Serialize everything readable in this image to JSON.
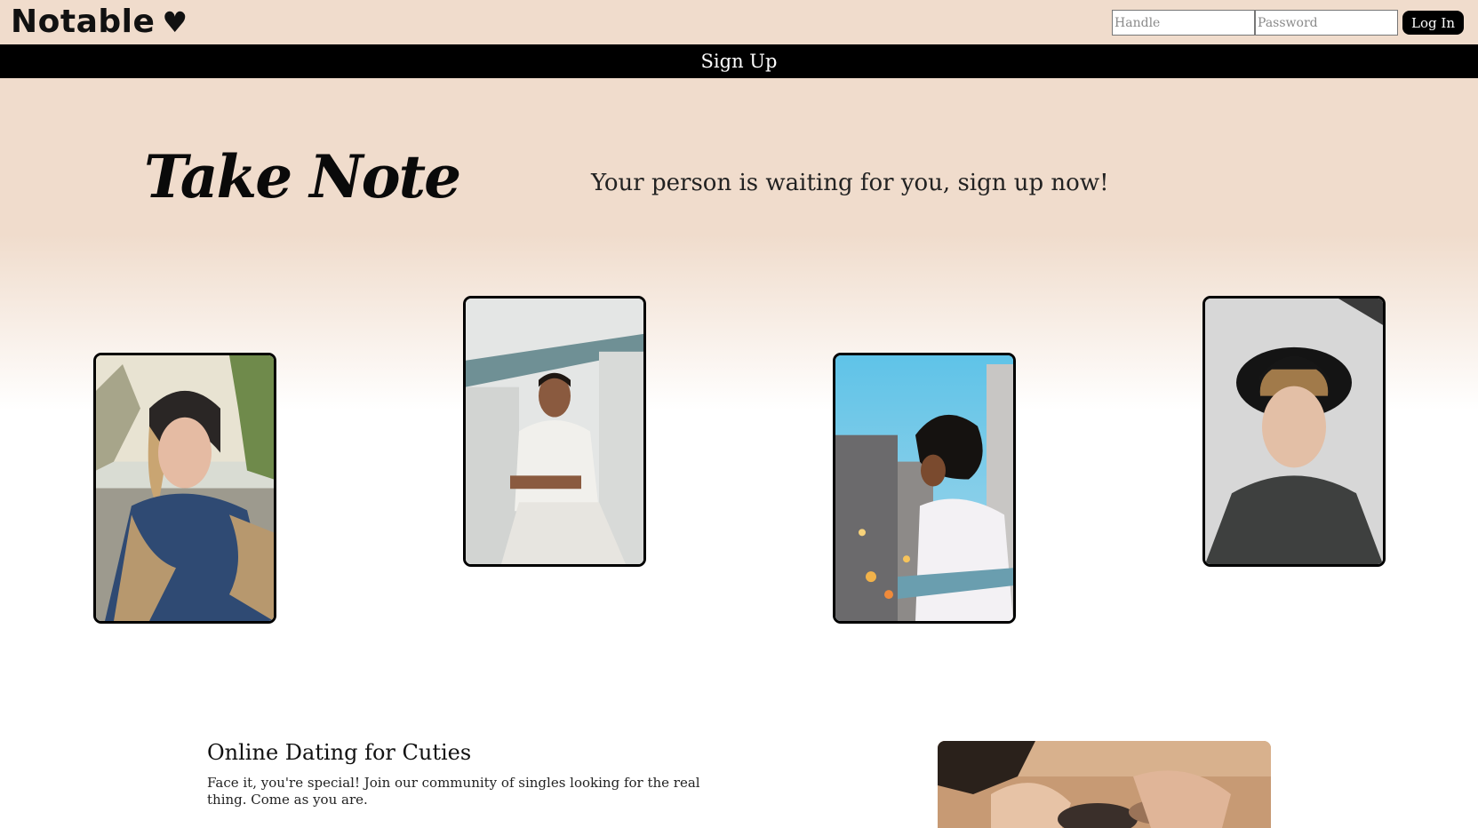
{
  "header": {
    "logo_text": "Notable",
    "logo_heart": "♥",
    "login": {
      "handle_placeholder": "Handle",
      "password_placeholder": "Password",
      "button_label": "Log In"
    }
  },
  "signup_bar": {
    "label": "Sign Up"
  },
  "hero": {
    "title": "Take Note",
    "tagline": "Your person is waiting for you, sign up now!"
  },
  "photos": [
    {
      "name": "profile-photo-woman-beanie"
    },
    {
      "name": "profile-photo-man-white-shirt"
    },
    {
      "name": "profile-photo-woman-city"
    },
    {
      "name": "profile-photo-man-hat"
    }
  ],
  "features": {
    "title": "Online Dating for Cuties",
    "text": "Face it, you're special! Join our community of singles looking for the real thing. Come as you are."
  },
  "colors": {
    "header_bg": "#f0dccc",
    "signup_bar_bg": "#000000",
    "accent": "#000000"
  }
}
